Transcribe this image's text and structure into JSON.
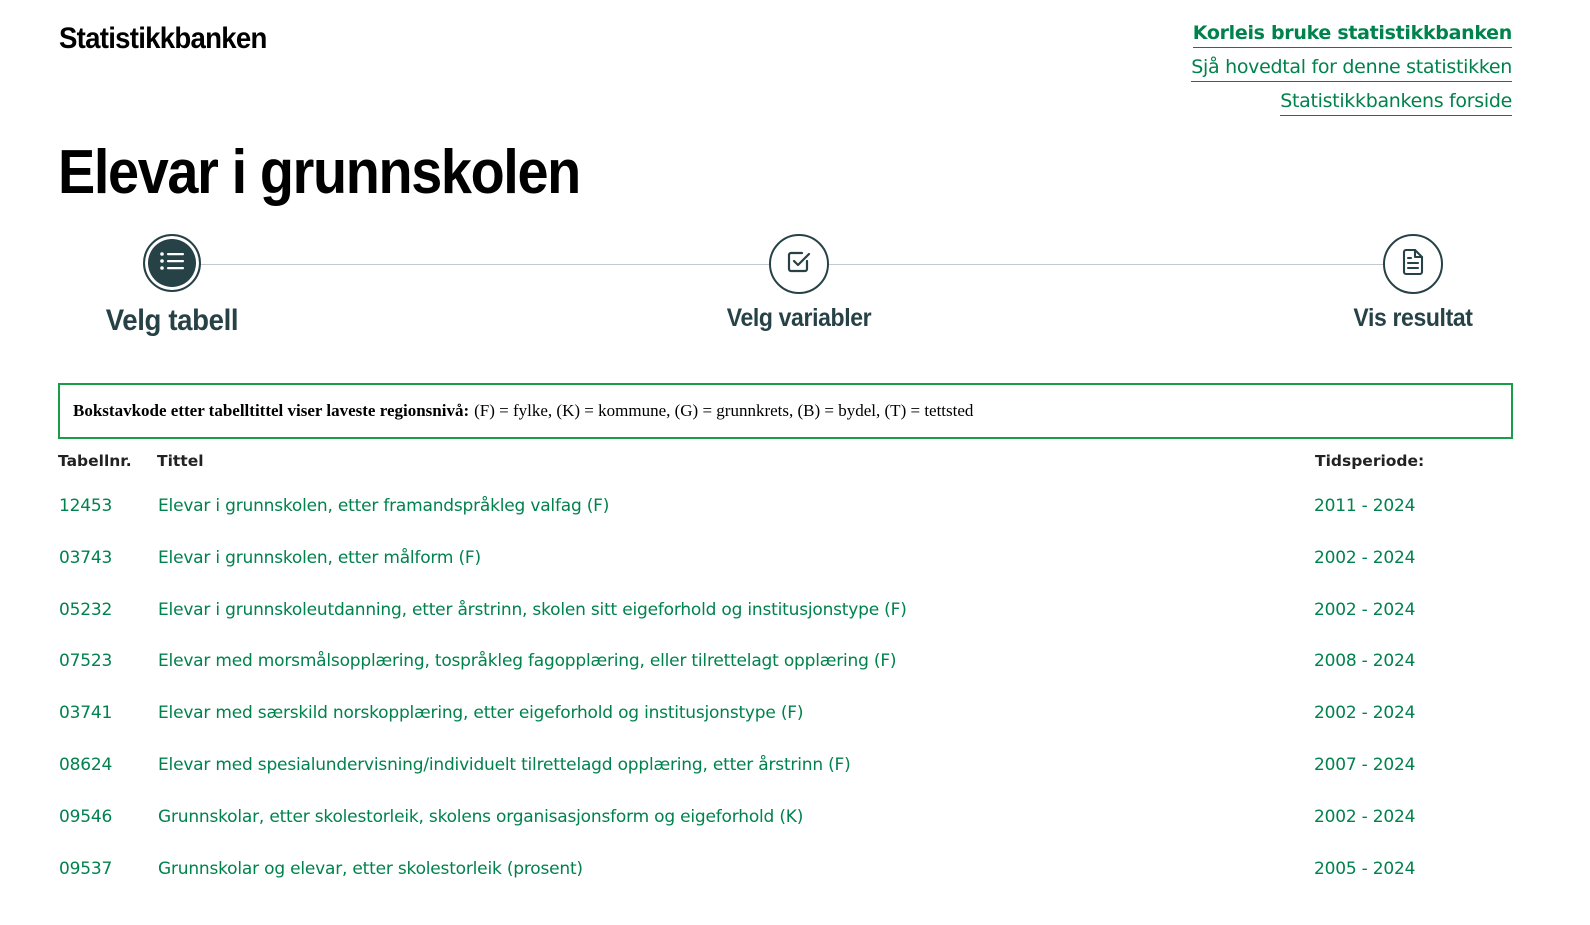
{
  "header": {
    "brand": "Statistikkbanken",
    "links": [
      {
        "label": "Korleis bruke statistikkbanken"
      },
      {
        "label": "Sjå hovedtal for denne statistikken"
      },
      {
        "label": "Statistikkbankens forside"
      }
    ]
  },
  "page_title": "Elevar i grunnskolen",
  "steps": [
    {
      "label": "Velg tabell",
      "icon": "list-icon",
      "active": true
    },
    {
      "label": "Velg variabler",
      "icon": "checkbox-icon",
      "active": false
    },
    {
      "label": "Vis resultat",
      "icon": "document-icon",
      "active": false
    }
  ],
  "info": {
    "bold": "Bokstavkode etter tabelltittel viser laveste regionsnivå:",
    "text": "(F) = fylke, (K) = kommune, (G) = grunnkrets, (B) = bydel, (T) = tettsted"
  },
  "table": {
    "headers": {
      "nr": "Tabellnr.",
      "title": "Tittel",
      "period": "Tidsperiode:"
    },
    "rows": [
      {
        "nr": "12453",
        "title": "Elevar i grunnskolen, etter framandspråkleg valfag (F)",
        "period": "2011 - 2024"
      },
      {
        "nr": "03743",
        "title": "Elevar i grunnskolen, etter målform (F)",
        "period": "2002 - 2024"
      },
      {
        "nr": "05232",
        "title": "Elevar i grunnskoleutdanning, etter årstrinn, skolen sitt eigeforhold og institusjonstype (F)",
        "period": "2002 - 2024"
      },
      {
        "nr": "07523",
        "title": "Elevar med morsmålsopplæring, tospråkleg fagopplæring, eller tilrettelagt opplæring (F)",
        "period": "2008 - 2024"
      },
      {
        "nr": "03741",
        "title": "Elevar med særskild norskopplæring, etter eigeforhold og institusjonstype (F)",
        "period": "2002 - 2024"
      },
      {
        "nr": "08624",
        "title": "Elevar med spesialundervisning/individuelt tilrettelagd opplæring, etter årstrinn (F)",
        "period": "2007 - 2024"
      },
      {
        "nr": "09546",
        "title": "Grunnskolar, etter skolestorleik, skolens organisasjonsform og eigeforhold (K)",
        "period": "2002 - 2024"
      },
      {
        "nr": "09537",
        "title": "Grunnskolar og elevar, etter skolestorleik (prosent)",
        "period": "2005 - 2024"
      }
    ]
  },
  "colors": {
    "accent": "#00824d",
    "dark": "#274247",
    "border": "#1a9d49"
  }
}
